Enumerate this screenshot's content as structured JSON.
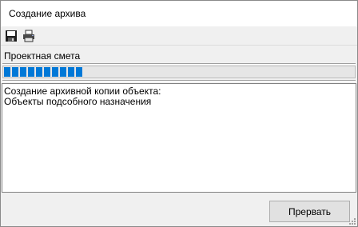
{
  "window": {
    "title": "Создание архива"
  },
  "toolbar": {
    "items": [
      {
        "icon": "save-icon",
        "label": ""
      },
      {
        "icon": "print-icon",
        "label": ""
      }
    ]
  },
  "object": {
    "name": "Проектная смета"
  },
  "progress": {
    "segments_filled": 10,
    "fraction": 0.21,
    "color": "#0078d7"
  },
  "log": {
    "lines": [
      "Создание архивной копии объекта:",
      "Объекты подсобного назначения"
    ]
  },
  "footer": {
    "cancel_label": "Прервать"
  }
}
